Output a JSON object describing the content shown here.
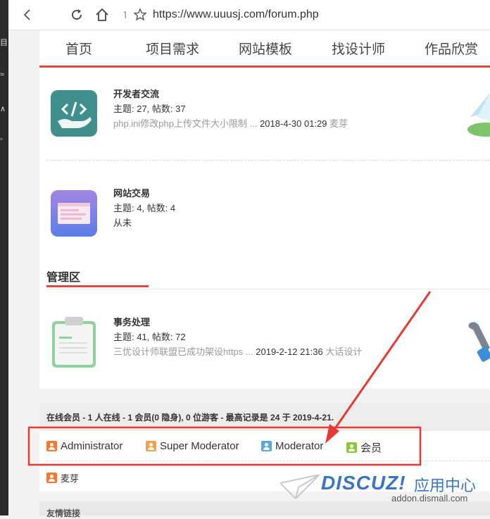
{
  "browser": {
    "url": "https://www.uuusj.com/forum.php"
  },
  "nav": {
    "items": [
      "首页",
      "项目需求",
      "网站模板",
      "找设计师",
      "作品欣赏"
    ]
  },
  "forums": [
    {
      "title": "开发者交流",
      "meta": "主题: 27, 帖数: 37",
      "last_thread": "php.ini修改php上传文件大小限制 ...",
      "last_time": "2018-4-30 01:29",
      "last_user": "麦芽"
    },
    {
      "title": "网站交易",
      "meta": "主题: 4, 帖数: 4",
      "last_thread": "从未"
    }
  ],
  "admin_section": {
    "title": "管理区",
    "forum": {
      "title": "事务处理",
      "meta": "主题: 41, 帖数: 72",
      "last_thread": "三优设计师联盟已成功架设https ...",
      "last_time": "2019-2-12 21:36",
      "last_user": "大话设计"
    }
  },
  "online": {
    "summary": "在线会员 - 1 人在线 - 1 会员(0 隐身), 0 位游客 - 最高记录是 24 于 2019-4-21.",
    "legend": [
      {
        "label": "Administrator",
        "color": "#f07a3a"
      },
      {
        "label": "Super Moderator",
        "color": "#f2a24a"
      },
      {
        "label": "Moderator",
        "color": "#5aa8d8"
      },
      {
        "label": "会员",
        "color": "#8cc63f"
      }
    ],
    "users": [
      {
        "label": "麦芽",
        "color": "#f07a3a"
      }
    ]
  },
  "friend_links": {
    "title": "友情链接"
  },
  "watermark": {
    "brand": "DISCUZ!",
    "cn": "应用中心",
    "url": "addon.dismall.com"
  },
  "colors": {
    "accent": "#e04848",
    "annotation": "#e53935"
  }
}
